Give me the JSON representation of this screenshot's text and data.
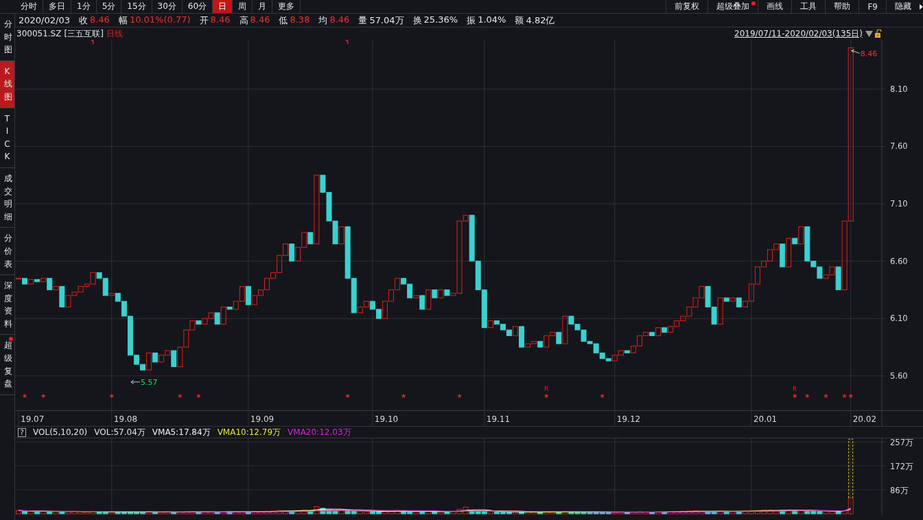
{
  "toolbar": {
    "tabs": [
      {
        "label": "分时",
        "selected": false
      },
      {
        "label": "多日",
        "selected": false
      },
      {
        "label": "1分",
        "selected": false
      },
      {
        "label": "5分",
        "selected": false
      },
      {
        "label": "15分",
        "selected": false
      },
      {
        "label": "30分",
        "selected": false
      },
      {
        "label": "60分",
        "selected": false
      },
      {
        "label": "日",
        "selected": true
      },
      {
        "label": "周",
        "selected": false
      },
      {
        "label": "月",
        "selected": false
      },
      {
        "label": "更多",
        "selected": false
      }
    ],
    "tools": [
      {
        "label": "前复权",
        "badge": false
      },
      {
        "label": "超级叠加",
        "badge": true
      },
      {
        "label": "画线",
        "badge": false
      },
      {
        "label": "工具",
        "badge": false
      },
      {
        "label": "帮助",
        "badge": false
      },
      {
        "label": "F9",
        "badge": false
      },
      {
        "label": "隐藏",
        "badge": false
      }
    ]
  },
  "sidebar": {
    "items": [
      {
        "label": "分时图",
        "selected": false,
        "badge": false
      },
      {
        "label": "K线图",
        "selected": true,
        "badge": false
      },
      {
        "label": "TICK",
        "selected": false,
        "badge": false
      },
      {
        "label": "成交明细",
        "selected": false,
        "badge": false
      },
      {
        "label": "分价表",
        "selected": false,
        "badge": false
      },
      {
        "label": "深度资料",
        "selected": false,
        "badge": false
      },
      {
        "label": "超级复盘",
        "selected": false,
        "badge": true
      }
    ]
  },
  "quote_bar": {
    "date": "2020/02/03",
    "items": [
      {
        "label": "收",
        "value": "8.46",
        "color": "#f0302e"
      },
      {
        "label": "幅",
        "value": "10.01%(0.77)",
        "color": "#f0302e"
      },
      {
        "label": "开",
        "value": "8.46",
        "color": "#f0302e"
      },
      {
        "label": "高",
        "value": "8.46",
        "color": "#f0302e"
      },
      {
        "label": "低",
        "value": "8.38",
        "color": "#f0302e"
      },
      {
        "label": "均",
        "value": "8.46",
        "color": "#f0302e"
      },
      {
        "label": "量",
        "value": "57.04万",
        "color": "#e6e6e6"
      },
      {
        "label": "换",
        "value": "25.36%",
        "color": "#e6e6e6"
      },
      {
        "label": "振",
        "value": "1.04%",
        "color": "#e6e6e6"
      },
      {
        "label": "额",
        "value": "4.82亿",
        "color": "#e6e6e6"
      }
    ]
  },
  "chart_header": {
    "symbol": "300051.SZ",
    "name": "[三五互联]",
    "period": "日线",
    "range": "2019/07/11-2020/02/03(135日)"
  },
  "price_chart": {
    "price_axis_labels": [
      "8.10",
      "7.60",
      "7.10",
      "6.60",
      "6.10",
      "5.60"
    ],
    "date_axis_labels": [
      "19.07",
      "19.08",
      "19.09",
      "19.10",
      "19.11",
      "19.12",
      "20.01",
      "20.02"
    ],
    "low_label": "5.57",
    "high_label": "8.46",
    "event_labels": [
      "R",
      "R"
    ]
  },
  "volume_chart": {
    "help_label": "?",
    "legend": [
      {
        "label": "VOL(5,10,20)"
      },
      {
        "label": "VOL:57.04万"
      },
      {
        "label": "VMA5:17.84万",
        "color": "#f2f2f2"
      },
      {
        "label": "VMA10:12.79万",
        "color": "#e8e43a"
      },
      {
        "label": "VMA20:12.03万",
        "color": "#e020e0"
      }
    ],
    "axis_labels": [
      "257万",
      "172万",
      "86万"
    ]
  }
}
